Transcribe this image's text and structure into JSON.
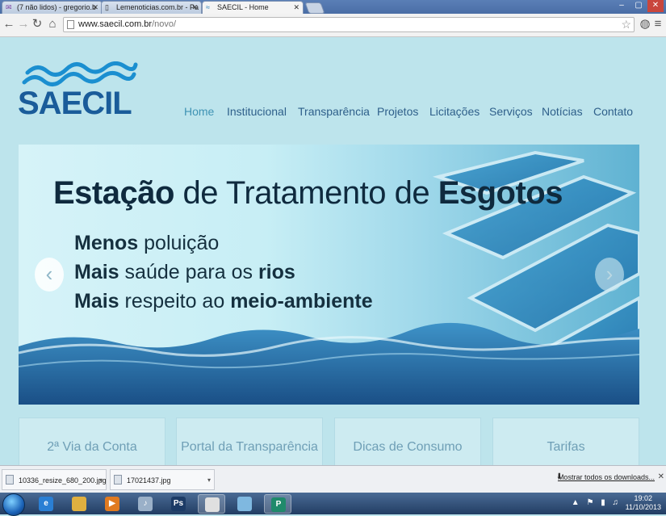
{
  "browser": {
    "tabs": [
      {
        "title": "(7 não lidos) - gregorio.b",
        "icon": "mail-icon"
      },
      {
        "title": "Lemenoticias.com.br - Pa",
        "icon": "page-icon"
      },
      {
        "title": "SAECIL - Home",
        "icon": "saecil-favicon",
        "active": true
      }
    ],
    "url_host": "www.saecil.com.br",
    "url_path": "/novo/",
    "window_controls": [
      "–",
      "▢",
      "✕"
    ]
  },
  "site": {
    "logo_text": "SAECIL",
    "nav": [
      {
        "label": "Home",
        "active": true
      },
      {
        "label": "Institucional"
      },
      {
        "label": "Transparência"
      },
      {
        "label": "Projetos"
      },
      {
        "label": "Licitações"
      },
      {
        "label": "Serviços"
      },
      {
        "label": "Notícias"
      },
      {
        "label": "Contato"
      }
    ],
    "banner": {
      "title_bold1": "Estação",
      "title_mid": " de Tratamento de ",
      "title_bold2": "Esgotos",
      "line1_bold": "Menos",
      "line1_rest": " poluição",
      "line2_bold": "Mais",
      "line2_mid": " saúde para os ",
      "line2_bold2": "rios",
      "line3_bold": "Mais",
      "line3_mid": " respeito ao ",
      "line3_bold2": "meio-ambiente",
      "prev_arrow": "‹",
      "next_arrow": "›"
    },
    "cards": [
      {
        "label": "2ª Via da Conta"
      },
      {
        "label": "Portal da Transparência"
      },
      {
        "label": "Dicas de Consumo"
      },
      {
        "label": "Tarifas"
      }
    ]
  },
  "downloads": {
    "items": [
      {
        "name": "10336_resize_680_200.jpg"
      },
      {
        "name": "17021437.jpg"
      }
    ],
    "show_all": "Mostrar todos os downloads...",
    "close": "✕"
  },
  "taskbar": {
    "apps": [
      {
        "name": "ie",
        "glyph": "e",
        "color": "#2a7fd4"
      },
      {
        "name": "explorer",
        "glyph": "",
        "color": "#e0b040"
      },
      {
        "name": "media-player",
        "glyph": "▶",
        "color": "#e07a20"
      },
      {
        "name": "itunes",
        "glyph": "♪",
        "color": "#9ab0c8"
      },
      {
        "name": "photoshop",
        "glyph": "Ps",
        "color": "#1c3b66"
      },
      {
        "name": "chrome",
        "glyph": "",
        "color": "#e0e0e0",
        "active": true
      },
      {
        "name": "paint",
        "glyph": "",
        "color": "#7fb8e0"
      },
      {
        "name": "publisher",
        "glyph": "P",
        "color": "#1f8a6b",
        "active": true
      }
    ],
    "time": "19:02",
    "date": "11/10/2013"
  }
}
